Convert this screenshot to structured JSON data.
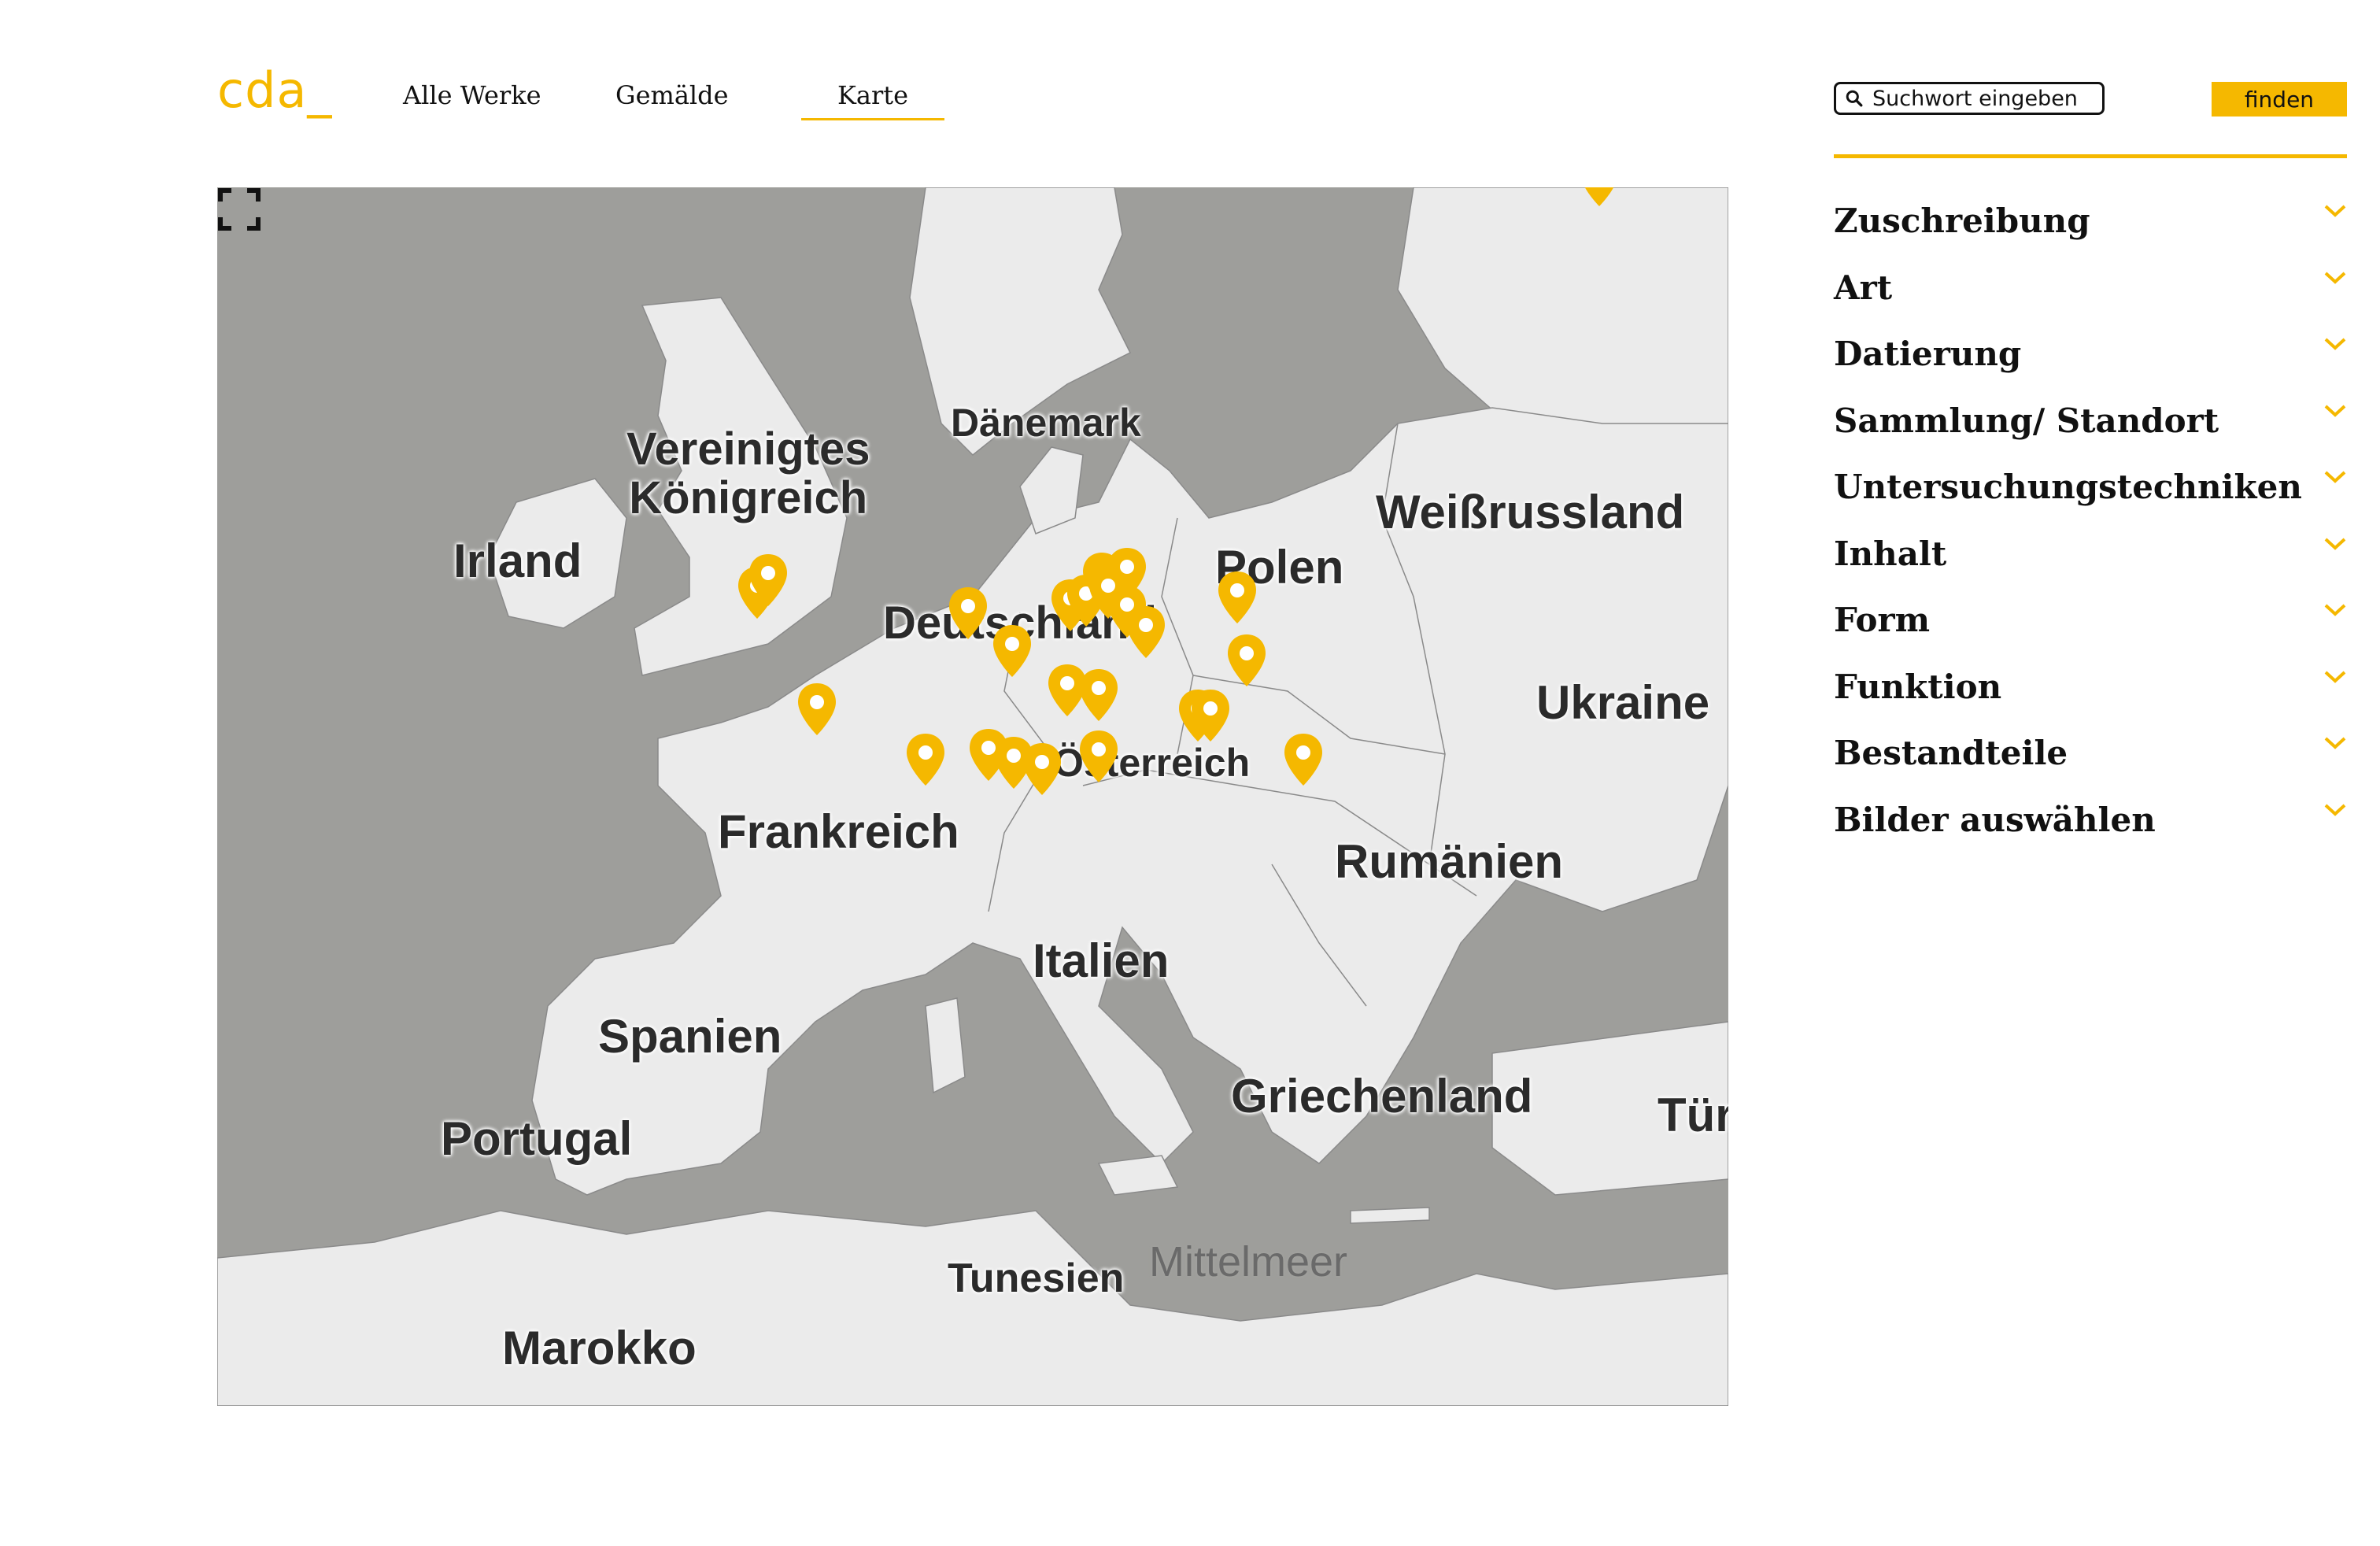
{
  "header": {
    "logo": "cda_",
    "nav": [
      {
        "label": "Alle Werke"
      },
      {
        "label": "Gemälde"
      },
      {
        "label": "Karte"
      }
    ],
    "active_nav": "Karte"
  },
  "search": {
    "placeholder": "Suchwort eingeben",
    "button_label": "finden"
  },
  "filters": [
    {
      "label": "Zuschreibung"
    },
    {
      "label": "Art"
    },
    {
      "label": "Datierung"
    },
    {
      "label": "Sammlung/ Standort"
    },
    {
      "label": "Untersuchungstechniken"
    },
    {
      "label": "Inhalt"
    },
    {
      "label": "Form"
    },
    {
      "label": "Funktion"
    },
    {
      "label": "Bestandteile"
    },
    {
      "label": "Bilder auswählen"
    }
  ],
  "map": {
    "labels": {
      "uk": [
        "Vereinigtes",
        "Königreich"
      ],
      "ireland": "Irland",
      "denmark": "Dänemark",
      "germany": "Deutschland",
      "poland": "Polen",
      "belarus": "Weißrussland",
      "ukraine": "Ukraine",
      "austria": "Österreich",
      "france": "Frankreich",
      "romania": "Rumänien",
      "italy": "Italien",
      "spain": "Spanien",
      "portugal": "Portugal",
      "greece": "Griechenland",
      "turkey": "Tür",
      "tunisia": "Tunesien",
      "mediterranean": "Mittelmeer",
      "morocco": "Marokko"
    },
    "marker_count": 26
  },
  "colors": {
    "accent": "#f5b800",
    "water": "#9e9e9b",
    "land": "#ebebeb",
    "text": "#111111"
  },
  "icons": {
    "search": "search-icon",
    "chevron": "chevron-down-icon",
    "marker": "map-marker-icon",
    "fullscreen": "fullscreen-icon"
  }
}
